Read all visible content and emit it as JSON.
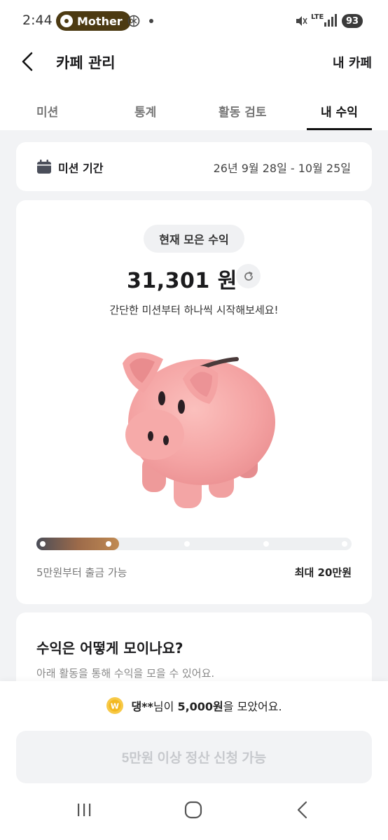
{
  "status_bar": {
    "time": "2:44",
    "app_pill": "Mother",
    "network": "LTE",
    "battery": "93"
  },
  "header": {
    "title": "카페 관리",
    "right_link": "내 카페"
  },
  "tabs": [
    {
      "label": "미션",
      "active": false
    },
    {
      "label": "통계",
      "active": false
    },
    {
      "label": "활동 검토",
      "active": false
    },
    {
      "label": "내 수익",
      "active": true
    }
  ],
  "period": {
    "label": "미션 기간",
    "value": "26년 9월 28일 - 10월 25일"
  },
  "earnings": {
    "pill_label": "현재 모은 수익",
    "amount": "31,301 원",
    "description": "간단한 미션부터 하나씩 시작해보세요!",
    "progress_fraction": 0.16,
    "min_label": "5만원부터 출금 가능",
    "max_label": "최대 20만원"
  },
  "how": {
    "title": "수익은 어떻게 모이나요?",
    "description": "아래 활동을 통해 수익을 모을 수 있어요."
  },
  "ticker": {
    "name": "댕**",
    "mid_text": "님이 ",
    "amount": "5,000원",
    "end_text": "을 모았어요."
  },
  "cta": {
    "label": "5만원 이상 정산 신청 가능"
  },
  "colors": {
    "accent_progress_start": "#4a4d58",
    "accent_progress_end": "#c08a52",
    "piggy_pink": "#f4a3a3",
    "mother_pill": "#4c3a12"
  }
}
